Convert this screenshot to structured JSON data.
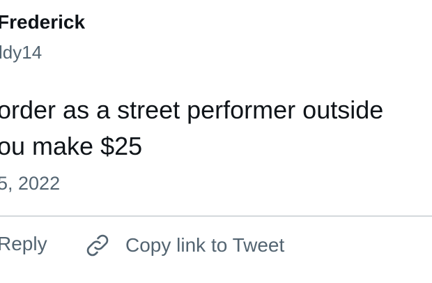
{
  "tweet": {
    "author_name": "Frederick",
    "author_handle": "ldy14",
    "body_lines": [
      "order as a street performer outside",
      "ou make $25"
    ],
    "timestamp": "5, 2022"
  },
  "actions": {
    "reply_label": "Reply",
    "copy_link_label": "Copy link to Tweet",
    "copy_link_icon": "link-icon"
  },
  "colors": {
    "text_primary": "#0f1419",
    "text_secondary": "#536471",
    "divider": "#d4d8dc",
    "background": "#ffffff"
  }
}
